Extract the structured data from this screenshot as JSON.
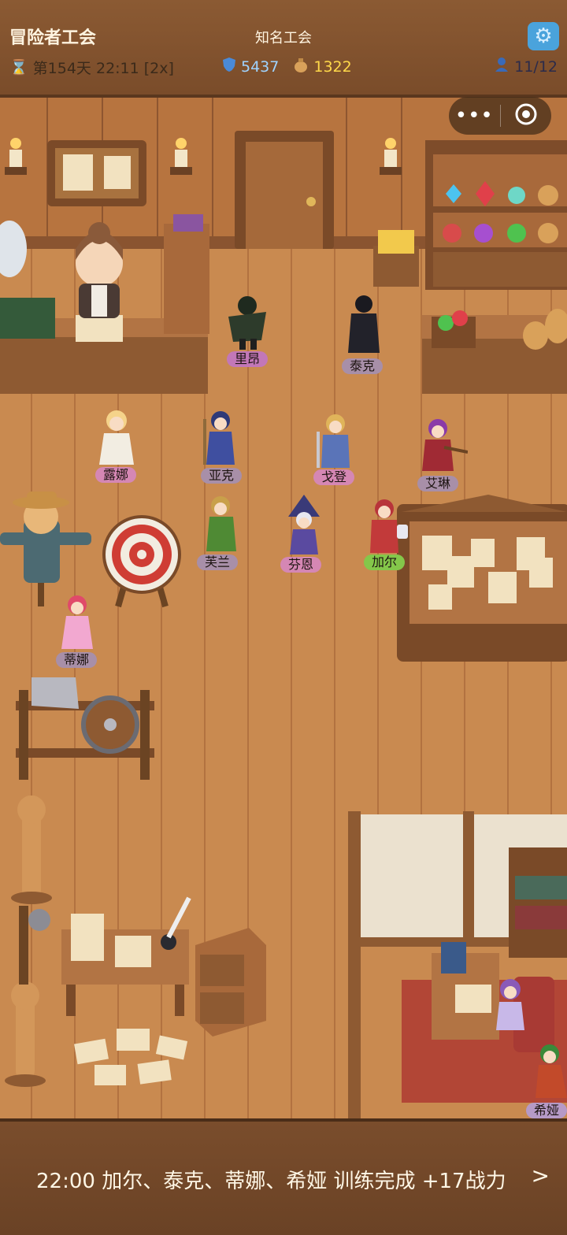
{
  "hud": {
    "title": "冒险者工会",
    "guild_rank": "知名工会",
    "day_time": "第154天 22:11 [2x]",
    "shield_value": "5437",
    "gold_value": "1322",
    "population": "11/12"
  },
  "characters": [
    {
      "name": "里昂"
    },
    {
      "name": "泰克"
    },
    {
      "name": "露娜"
    },
    {
      "name": "亚克"
    },
    {
      "name": "戈登"
    },
    {
      "name": "艾琳"
    },
    {
      "name": "芙兰"
    },
    {
      "name": "芬恩"
    },
    {
      "name": "加尔"
    },
    {
      "name": "蒂娜"
    },
    {
      "name": "希娅"
    }
  ],
  "log": {
    "message": "22:00 加尔、泰克、蒂娜、希娅 训练完成 +17战力",
    "arrow": ">"
  },
  "colors": {
    "floor": "#c98a50",
    "wall": "#b7743f",
    "accent_blue": "#4aa3dc",
    "gold_text": "#ffd84a",
    "shield_text": "#9fd3ff"
  }
}
